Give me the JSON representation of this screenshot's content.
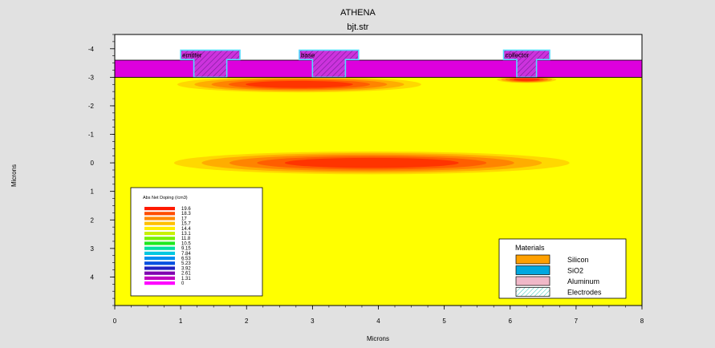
{
  "chart_data": {
    "type": "contour",
    "title": "ATHENA",
    "subtitle": "bjt.str",
    "xlabel": "Microns",
    "ylabel": "Microns",
    "xlim": [
      0,
      8
    ],
    "ylim": [
      -4.5,
      5
    ],
    "x_ticks": [
      "0",
      "1",
      "2",
      "3",
      "4",
      "5",
      "6",
      "7",
      "8"
    ],
    "x_tick_values": [
      0,
      1,
      2,
      3,
      4,
      5,
      6,
      7,
      8
    ],
    "y_ticks": [
      "-4",
      "-3",
      "-2",
      "-1",
      "0",
      "1",
      "2",
      "3",
      "4"
    ],
    "y_tick_values": [
      -4,
      -3,
      -2,
      -1,
      0,
      1,
      2,
      3,
      4
    ],
    "layers": {
      "oxide_top": -3.6,
      "oxide_bottom": -3.0
    },
    "electrodes": [
      {
        "name": "emitter",
        "x_left": 1.0,
        "x_right": 1.9,
        "stem_left": 1.2,
        "stem_right": 1.7,
        "top": -3.95,
        "cap_bottom": -3.62,
        "bottom": -3.0
      },
      {
        "name": "base",
        "x_left": 2.8,
        "x_right": 3.7,
        "stem_left": 3.0,
        "stem_right": 3.5,
        "top": -3.95,
        "cap_bottom": -3.62,
        "bottom": -3.0
      },
      {
        "name": "collector",
        "x_left": 5.9,
        "x_right": 6.6,
        "stem_left": 6.1,
        "stem_right": 6.4,
        "top": -3.95,
        "cap_bottom": -3.62,
        "bottom": -3.0
      }
    ],
    "doping_regions": [
      {
        "cx": 3.9,
        "cy": 0.0,
        "rx": 3.0,
        "ry": 0.4
      },
      {
        "cx": 2.8,
        "cy": -2.75,
        "rx": 1.85,
        "ry": 0.28
      },
      {
        "cx": 6.25,
        "cy": -2.92,
        "rx": 0.45,
        "ry": 0.12
      }
    ],
    "legend": {
      "title": "Abs Net Doping (/cm3)",
      "values": [
        "19.6",
        "18.3",
        "17",
        "15.7",
        "14.4",
        "13.1",
        "11.8",
        "10.5",
        "9.15",
        "7.84",
        "6.53",
        "5.23",
        "3.92",
        "2.61",
        "1.31",
        "0"
      ],
      "colors": [
        "#ff1a00",
        "#ff4d00",
        "#ff8a00",
        "#ffc000",
        "#ffee00",
        "#c8f000",
        "#78f000",
        "#20e820",
        "#00e0a0",
        "#00c8e0",
        "#0090f0",
        "#0050e0",
        "#2020c0",
        "#8000b0",
        "#c000c0",
        "#ff00ff"
      ]
    },
    "materials": {
      "title": "Materials",
      "items": [
        {
          "name": "Silicon",
          "color": "#ffa000"
        },
        {
          "name": "SiO2",
          "color": "#00a8e0"
        },
        {
          "name": "Aluminum",
          "color": "#f0b8c8"
        },
        {
          "name": "Electrodes",
          "color": "#ffffff"
        }
      ]
    },
    "colors": {
      "background": "#e1e1e1",
      "silicon": "#ffff00",
      "oxide": "#dd00dd",
      "electrode_fill": "#cc33dd",
      "electrode_edge": "#55ddff"
    }
  }
}
